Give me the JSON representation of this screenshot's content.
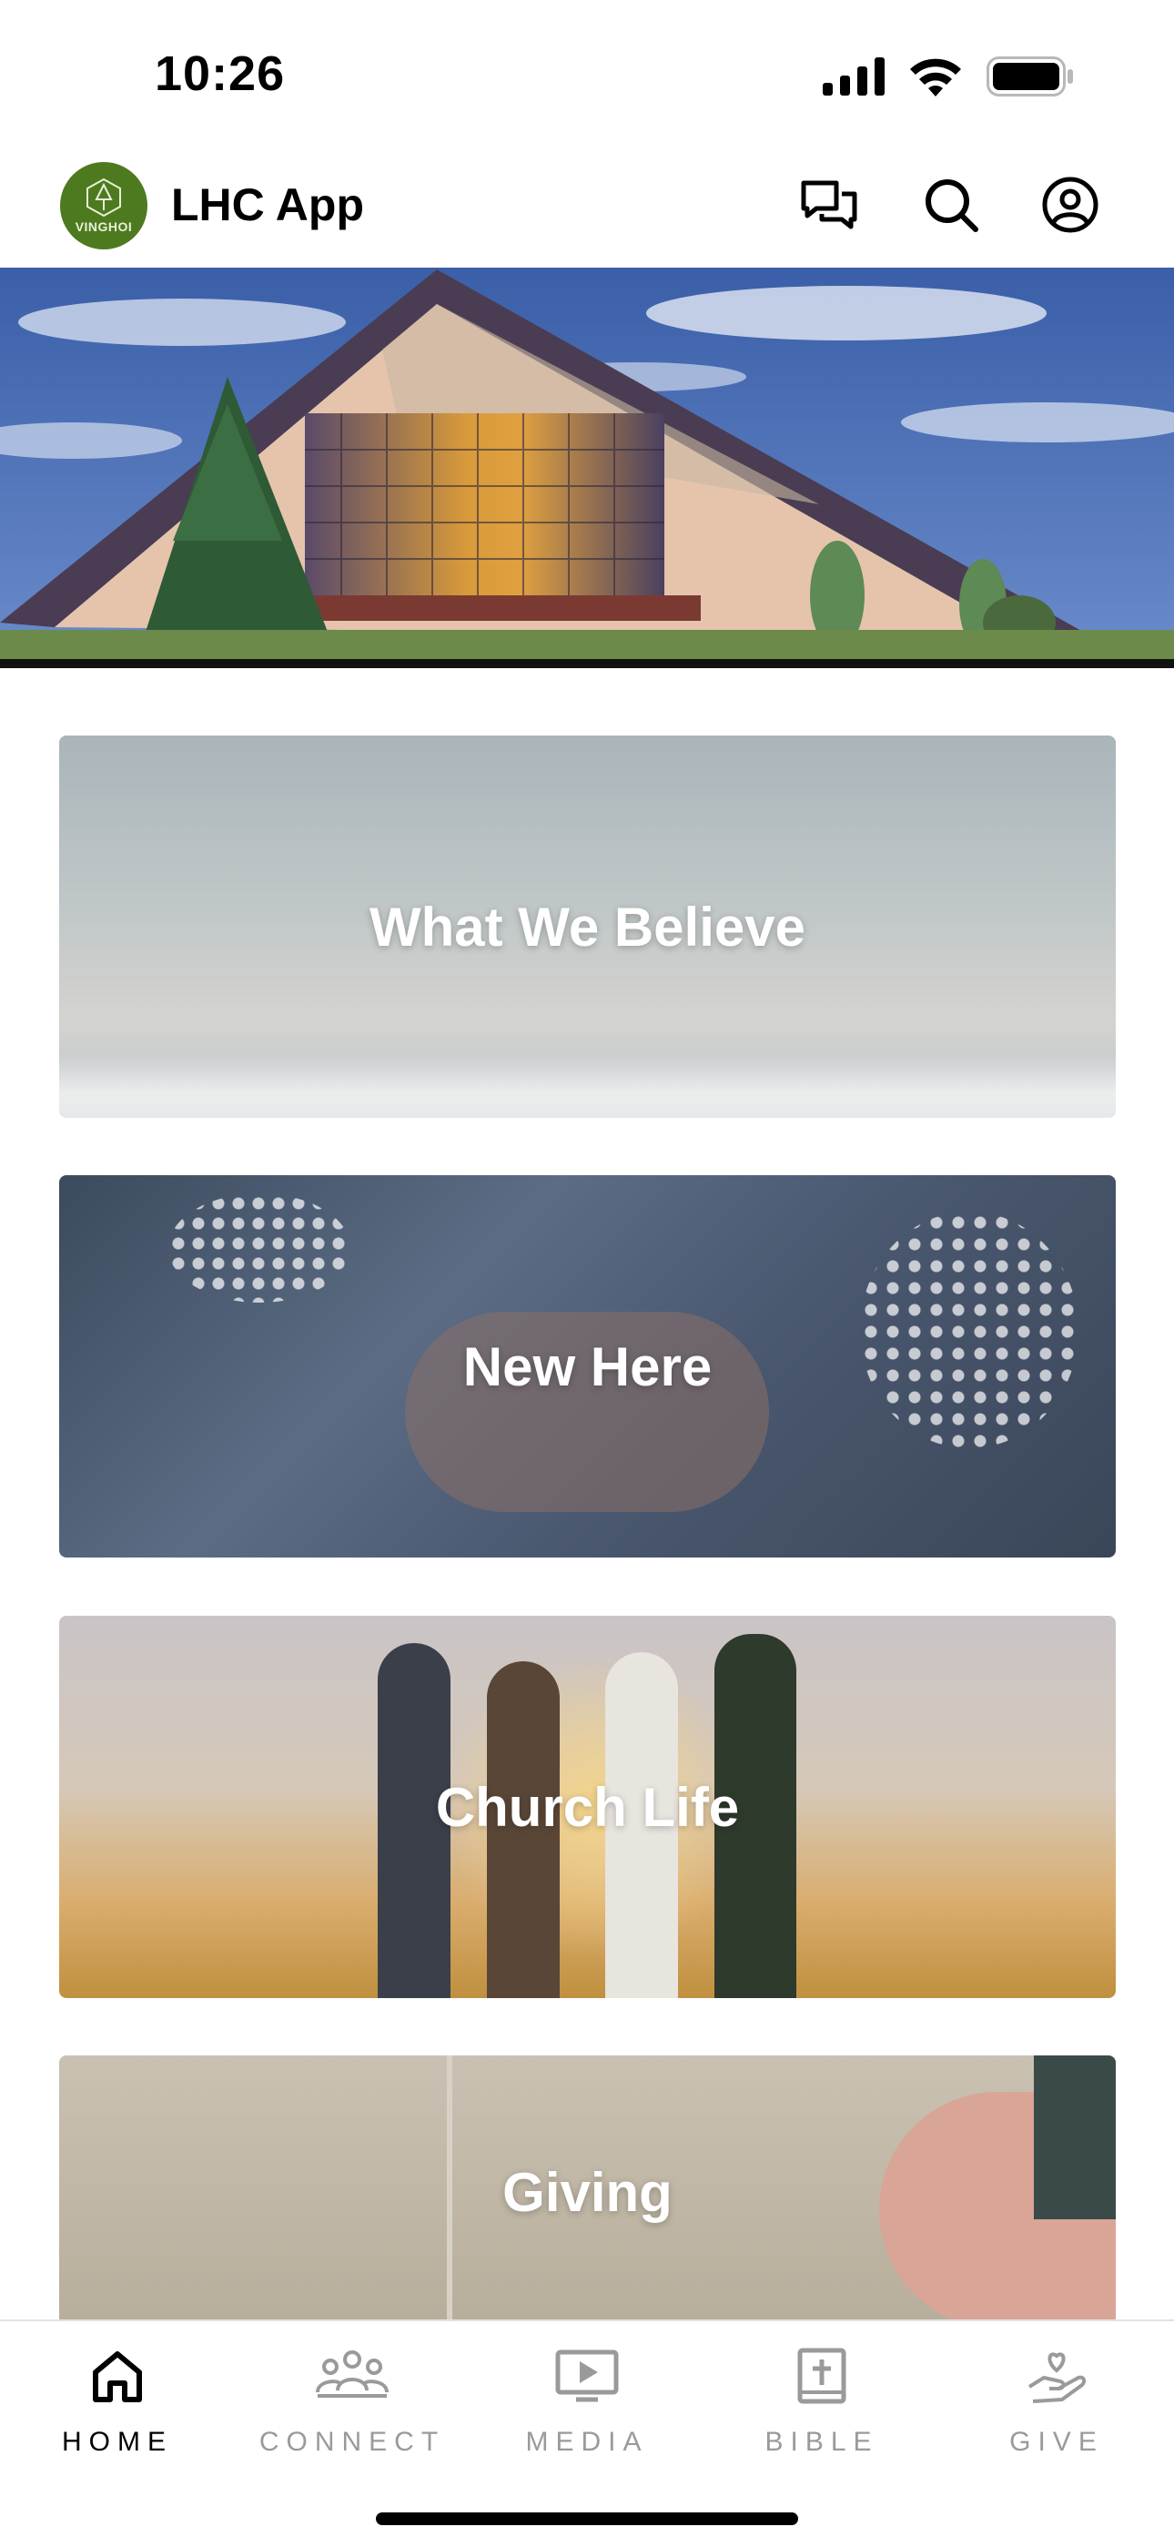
{
  "status_bar": {
    "time": "10:26"
  },
  "header": {
    "app_title": "LHC App",
    "logo_text": "VINGHOI"
  },
  "cards": [
    {
      "label": "What We Believe"
    },
    {
      "label": "New Here"
    },
    {
      "label": "Church Life"
    },
    {
      "label": "Giving"
    }
  ],
  "tabs": [
    {
      "label": "HOME",
      "icon": "home-icon",
      "active": true
    },
    {
      "label": "CONNECT",
      "icon": "people-icon",
      "active": false
    },
    {
      "label": "MEDIA",
      "icon": "play-screen-icon",
      "active": false
    },
    {
      "label": "BIBLE",
      "icon": "bible-icon",
      "active": false
    },
    {
      "label": "GIVE",
      "icon": "hand-heart-icon",
      "active": false
    }
  ],
  "colors": {
    "accent": "#000000",
    "inactive": "#9a9a9a",
    "logo_green": "#4d7a1f"
  }
}
